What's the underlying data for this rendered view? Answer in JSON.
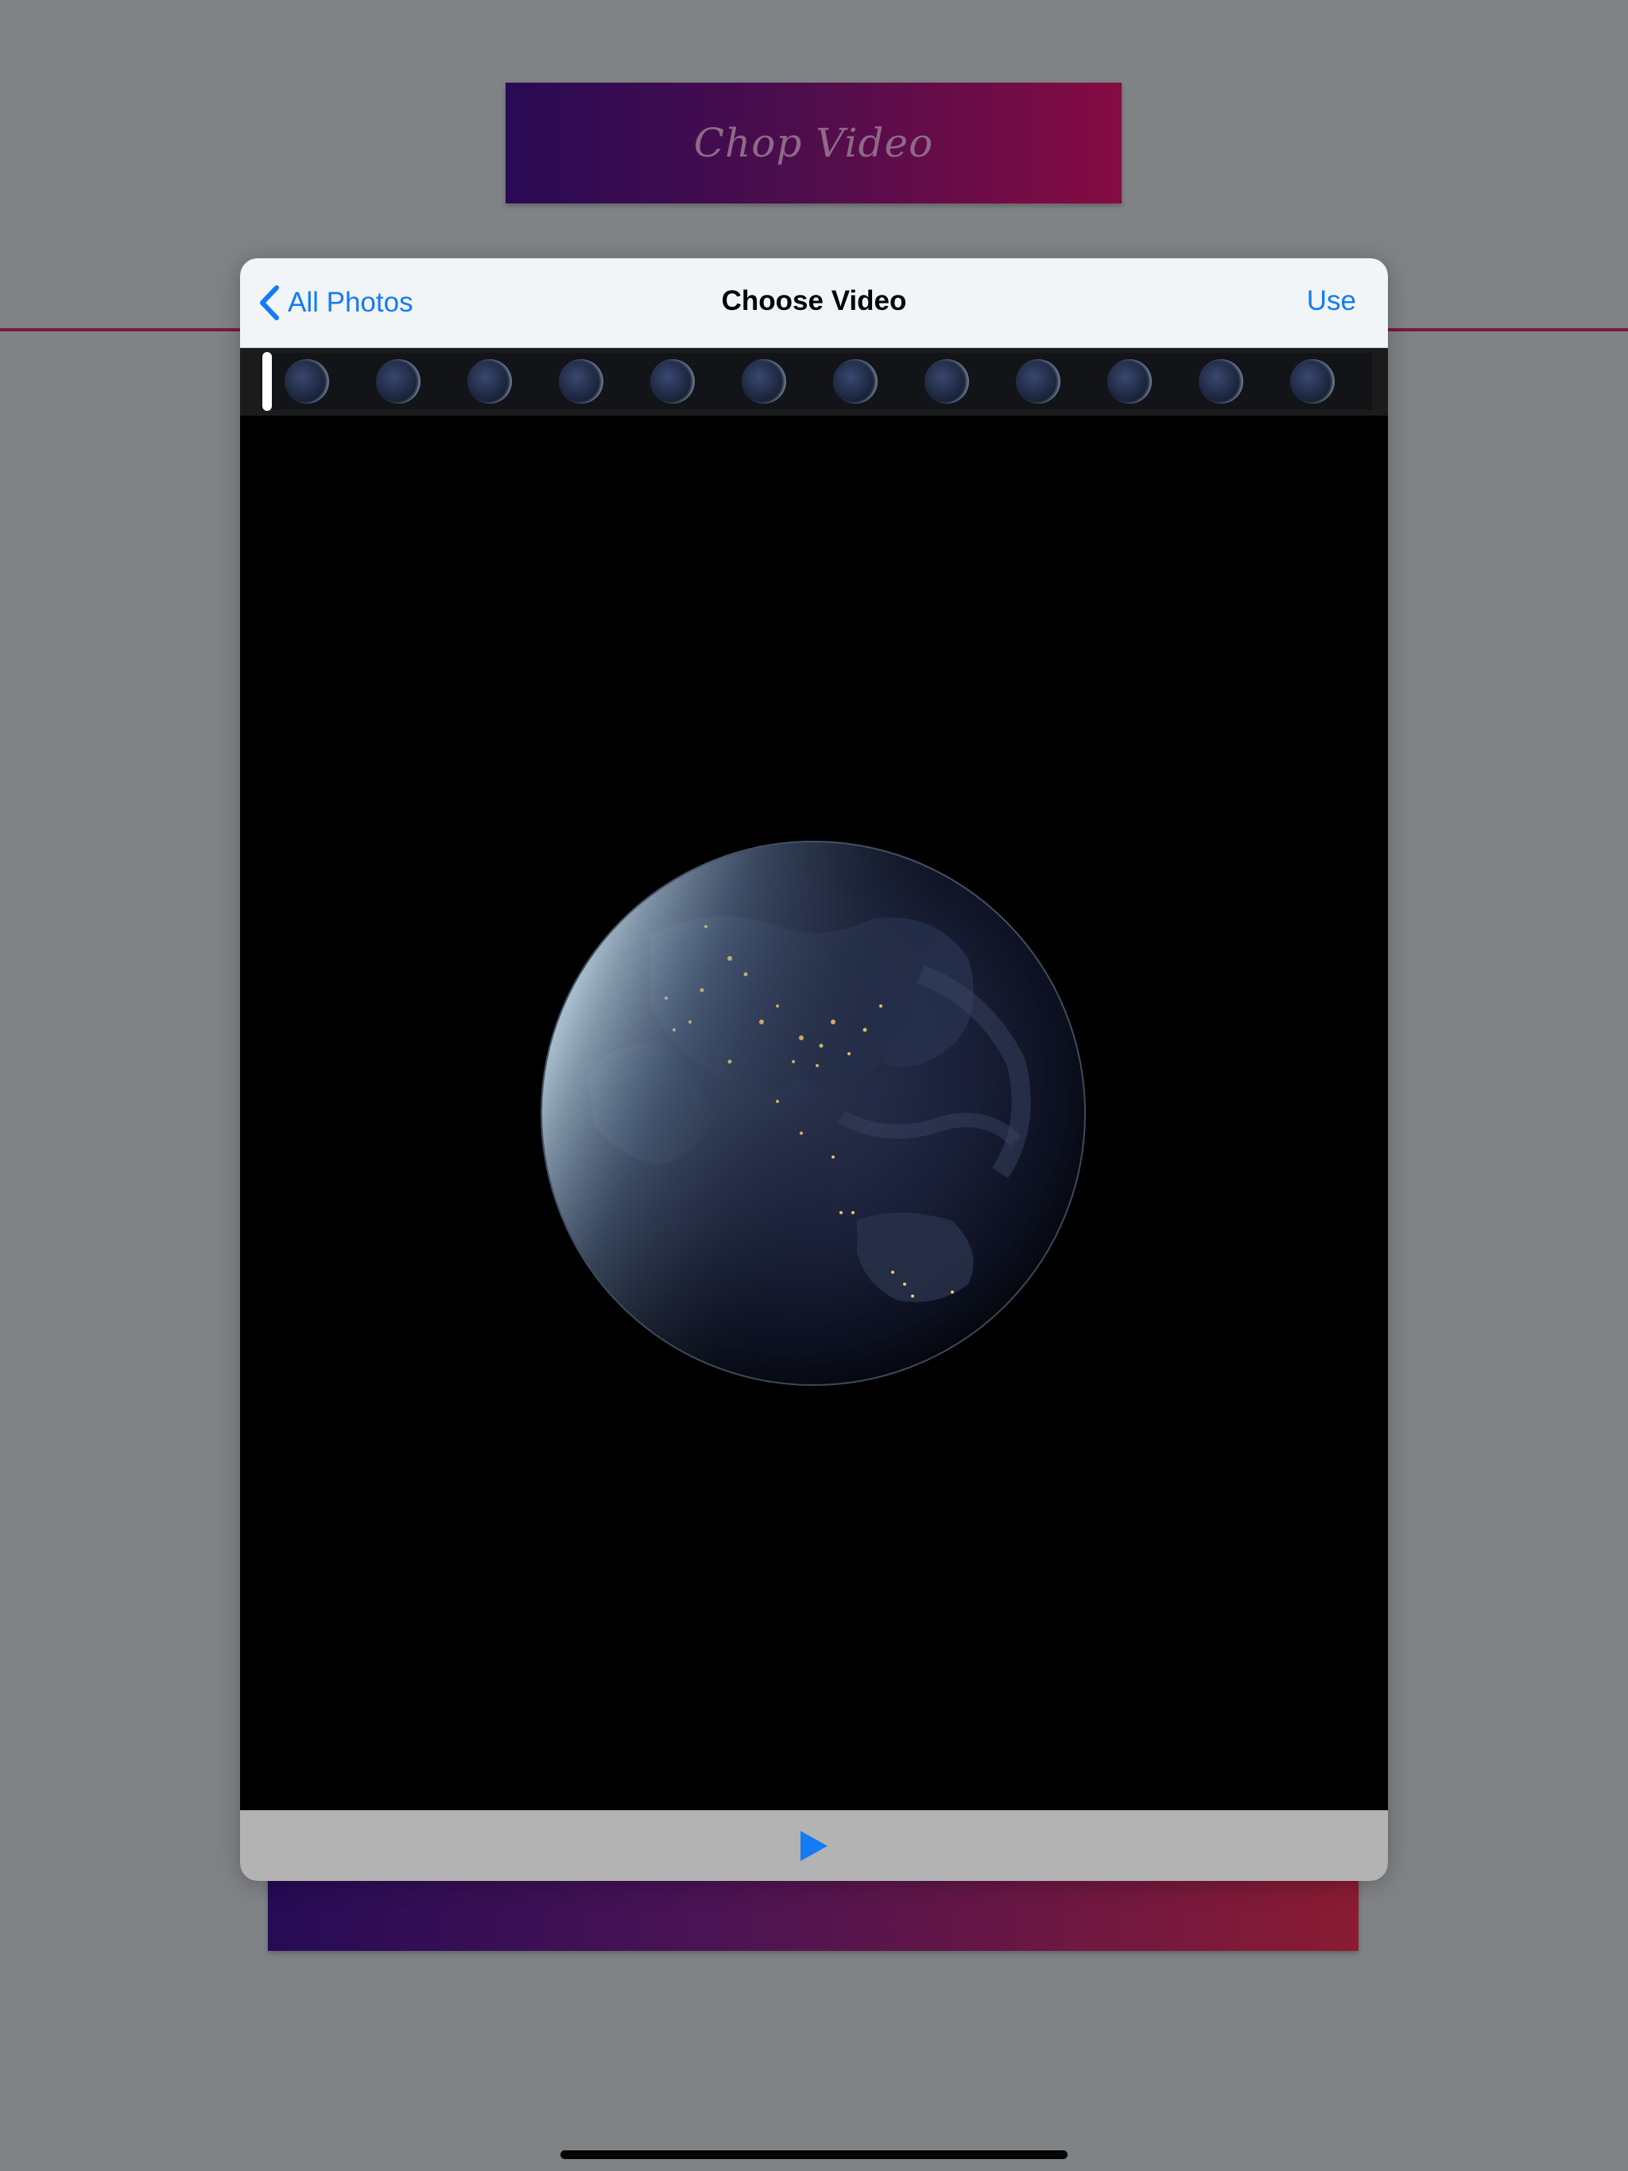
{
  "background_app": {
    "banner_title": "Chop Video",
    "colors": {
      "banner_start": "#290a54",
      "banner_end": "#860b43",
      "divider": "#7a1844",
      "backdrop": "#808386"
    }
  },
  "picker": {
    "back_label": "All Photos",
    "title": "Choose Video",
    "use_label": "Use",
    "accent_color": "#157af6",
    "filmstrip": {
      "frame_icon": "earth-thumbnail",
      "frame_count": 12,
      "scrubber_position": 0
    },
    "preview": {
      "icon": "earth-at-night"
    },
    "toolbar": {
      "play_icon": "play-icon"
    }
  }
}
